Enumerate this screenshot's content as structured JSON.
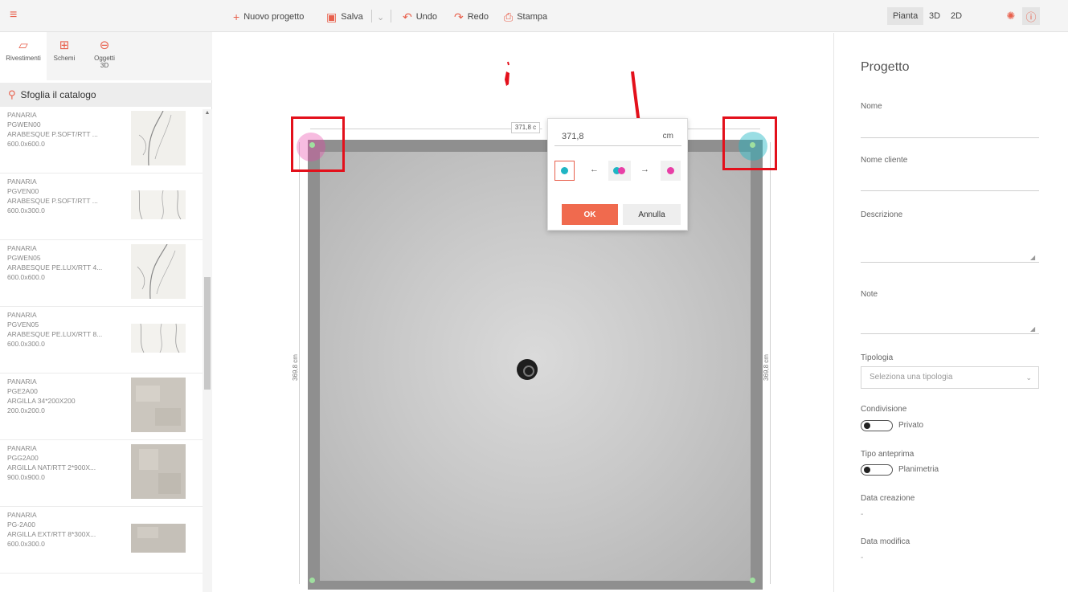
{
  "toolbar": {
    "new_project": "Nuovo progetto",
    "save": "Salva",
    "undo": "Undo",
    "redo": "Redo",
    "print": "Stampa",
    "views": [
      "Pianta",
      "3D",
      "2D"
    ],
    "active_view": "Pianta"
  },
  "sidebar": {
    "tabs": [
      {
        "label": "Rivestimenti",
        "icon": "tile-icon"
      },
      {
        "label": "Schemi",
        "icon": "grid-icon"
      },
      {
        "label": "Oggetti 3D",
        "icon": "armchair-icon"
      }
    ],
    "catalog_search": "Sfoglia il catalogo",
    "products": [
      {
        "brand": "PANARIA",
        "code": "PGWEN00",
        "name": "ARABESQUE P.SOFT/RTT ...",
        "size": "600.0x600.0"
      },
      {
        "brand": "PANARIA",
        "code": "PGVEN00",
        "name": "ARABESQUE P.SOFT/RTT ...",
        "size": "600.0x300.0"
      },
      {
        "brand": "PANARIA",
        "code": "PGWEN05",
        "name": "ARABESQUE PE.LUX/RTT 4...",
        "size": "600.0x600.0"
      },
      {
        "brand": "PANARIA",
        "code": "PGVEN05",
        "name": "ARABESQUE PE.LUX/RTT 8...",
        "size": "600.0x300.0"
      },
      {
        "brand": "PANARIA",
        "code": "PGE2A00",
        "name": "ARGILLA 34*200X200",
        "size": "200.0x200.0"
      },
      {
        "brand": "PANARIA",
        "code": "PGG2A00",
        "name": "ARGILLA NAT/RTT 2*900X...",
        "size": "900.0x900.0"
      },
      {
        "brand": "PANARIA",
        "code": "PG-2A00",
        "name": "ARGILLA EXT/RTT 8*300X...",
        "size": "600.0x300.0"
      }
    ]
  },
  "canvas": {
    "top_dimension": "371,8 c",
    "left_dimension": "369,8 cm",
    "right_dimension": "369,8 cm",
    "popup": {
      "value": "371,8",
      "unit": "cm",
      "ok": "OK",
      "cancel": "Annulla",
      "colors": {
        "cyan": "#1fb5c4",
        "magenta": "#e83fa6"
      }
    }
  },
  "project_panel": {
    "title": "Progetto",
    "name_label": "Nome",
    "client_label": "Nome cliente",
    "description_label": "Descrizione",
    "notes_label": "Note",
    "type_label": "Tipologia",
    "type_placeholder": "Seleziona una tipologia",
    "sharing_label": "Condivisione",
    "sharing_value": "Privato",
    "preview_label": "Tipo anteprima",
    "preview_value": "Planimetria",
    "created_label": "Data creazione",
    "created_value": "-",
    "modified_label": "Data modifica",
    "modified_value": "-"
  },
  "colors": {
    "accent": "#e8604c",
    "annotation": "#e3101b"
  }
}
